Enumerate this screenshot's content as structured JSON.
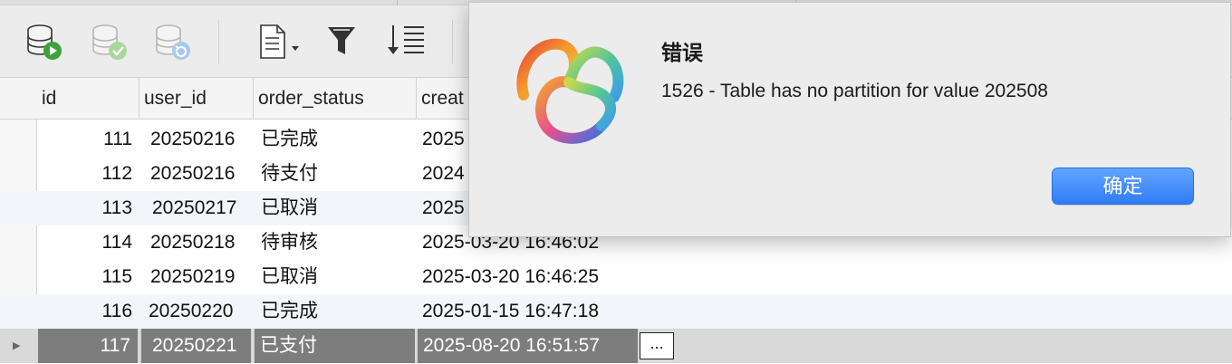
{
  "toolbar": {
    "buttons": [
      {
        "id": "run",
        "icon": "database-run-icon"
      },
      {
        "id": "commit",
        "icon": "database-check-icon"
      },
      {
        "id": "refresh",
        "icon": "database-refresh-icon"
      },
      {
        "id": "document",
        "icon": "document-dropdown-icon"
      },
      {
        "id": "filter",
        "icon": "filter-icon"
      },
      {
        "id": "sort",
        "icon": "sort-icon"
      }
    ]
  },
  "grid": {
    "columns": [
      {
        "key": "id",
        "label": "id"
      },
      {
        "key": "user_id",
        "label": "user_id"
      },
      {
        "key": "order_status",
        "label": "order_status"
      },
      {
        "key": "create",
        "label": "creat"
      }
    ],
    "rows": [
      {
        "id": "111",
        "user_id": "20250216",
        "order_status": "已完成",
        "create": "2025"
      },
      {
        "id": "112",
        "user_id": "20250216",
        "order_status": "待支付",
        "create": "2024"
      },
      {
        "id": "113",
        "user_id": "20250217",
        "order_status": "已取消",
        "create": "2025"
      },
      {
        "id": "114",
        "user_id": "20250218",
        "order_status": "待审核",
        "create": "2025-03-20 16:46:02"
      },
      {
        "id": "115",
        "user_id": "20250219",
        "order_status": "已取消",
        "create": "2025-03-20 16:46:25"
      },
      {
        "id": "116",
        "user_id": "20250220",
        "order_status": "已完成",
        "create": "2025-01-15 16:47:18"
      },
      {
        "id": "117",
        "user_id": "20250221",
        "order_status": "已支付",
        "create": "2025-08-20 16:51:57"
      }
    ],
    "selected_marker": "▶",
    "ellipsis": "..."
  },
  "dialog": {
    "title": "错误",
    "message": "1526 - Table has no partition for value 202508",
    "ok_label": "确定",
    "logo_icon": "navicat-logo-icon"
  },
  "colors": {
    "selected_cell": "#7d7d7d",
    "ok_button": "#3b86f8",
    "alt_row": "#f2f5f9"
  }
}
